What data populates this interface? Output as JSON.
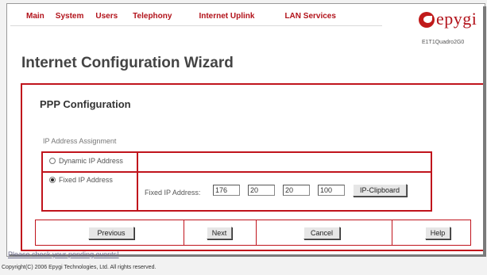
{
  "topnav": {
    "items": [
      {
        "label": "Main"
      },
      {
        "label": "System"
      },
      {
        "label": "Users"
      },
      {
        "label": "Telephony"
      },
      {
        "label": "Internet Uplink"
      },
      {
        "label": "LAN Services"
      }
    ]
  },
  "brand": {
    "logo_text": "epygi",
    "model": "E1T1Quadro2G0",
    "accent_color": "#c0141c"
  },
  "page_title": "Internet Configuration Wizard",
  "panel": {
    "title": "PPP Configuration",
    "section_label": "IP Address Assignment",
    "options": [
      {
        "label": "Dynamic IP Address",
        "selected": false
      },
      {
        "label": "Fixed IP Address",
        "selected": true
      }
    ],
    "fixed_ip_label": "Fixed IP Address:",
    "ip_octets": [
      "176",
      "20",
      "20",
      "100"
    ],
    "clipboard_button": "IP-Clipboard"
  },
  "buttons": {
    "previous": "Previous",
    "next": "Next",
    "cancel": "Cancel",
    "help": "Help"
  },
  "footer": {
    "pending_link": "Please check your pending events!",
    "copyright": "Copyright(C) 2006 Epygi Technologies, Ltd. All rights reserved."
  }
}
